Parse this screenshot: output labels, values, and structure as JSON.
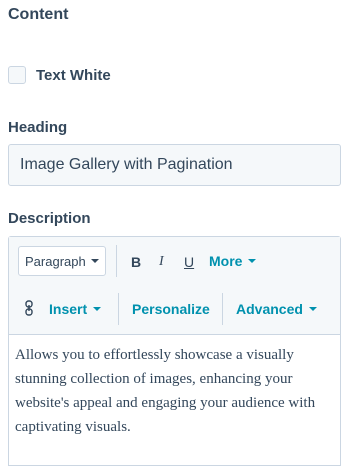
{
  "section": {
    "title": "Content"
  },
  "checkbox": {
    "label": "Text White",
    "checked": false
  },
  "heading": {
    "label": "Heading",
    "value": "Image Gallery with Pagination"
  },
  "description": {
    "label": "Description",
    "toolbar": {
      "block_format": "Paragraph",
      "bold": "B",
      "italic": "I",
      "underline": "U",
      "more": "More",
      "insert": "Insert",
      "personalize": "Personalize",
      "advanced": "Advanced"
    },
    "body": "Allows you to effortlessly showcase a visually stunning collection of images, enhancing your website's appeal and engaging your audience with captivating visuals."
  },
  "colors": {
    "text": "#33475b",
    "link": "#0091ae",
    "border": "#cbd6e2",
    "toolbar_bg": "#f5f8fa"
  },
  "icons": {
    "link": "chain-link-icon"
  }
}
